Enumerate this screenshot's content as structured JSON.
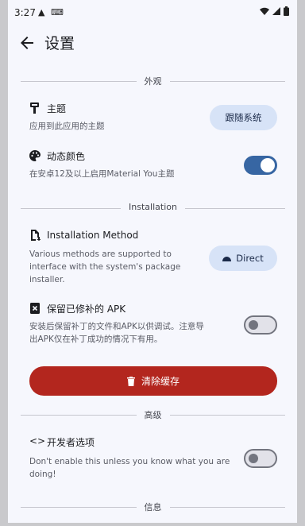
{
  "status_bar": {
    "time": "3:27"
  },
  "app_bar": {
    "title": "设置"
  },
  "sections": {
    "appearance": "外观",
    "installation": "Installation",
    "advanced": "高级",
    "info": "信息"
  },
  "theme": {
    "title": "主题",
    "subtitle": "应用到此应用的主题",
    "button": "跟随系统"
  },
  "dynamic_color": {
    "title": "动态颜色",
    "subtitle": "在安卓12及以上启用Material You主题",
    "enabled": true
  },
  "install_method": {
    "title": "Installation Method",
    "subtitle_lines": [
      "Various methods are supported to",
      "interface with the system's package",
      "installer."
    ],
    "button": "Direct"
  },
  "keep_apk": {
    "title": "保留已修补的 APK",
    "subtitle_lines": [
      "安装后保留补丁的文件和APK以供调试。注意导",
      "出APK仅在补丁成功的情况下有用。"
    ],
    "enabled": false
  },
  "clear_cache": {
    "label": "清除缓存"
  },
  "developer": {
    "title": "开发者选项",
    "subtitle_lines": [
      "Don't enable this unless you know what you are",
      "doing!"
    ],
    "enabled": false
  },
  "colors": {
    "accent": "#3766a3",
    "danger": "#b3261e",
    "tonal": "#d7e3f7",
    "background": "#f6f7fd"
  }
}
